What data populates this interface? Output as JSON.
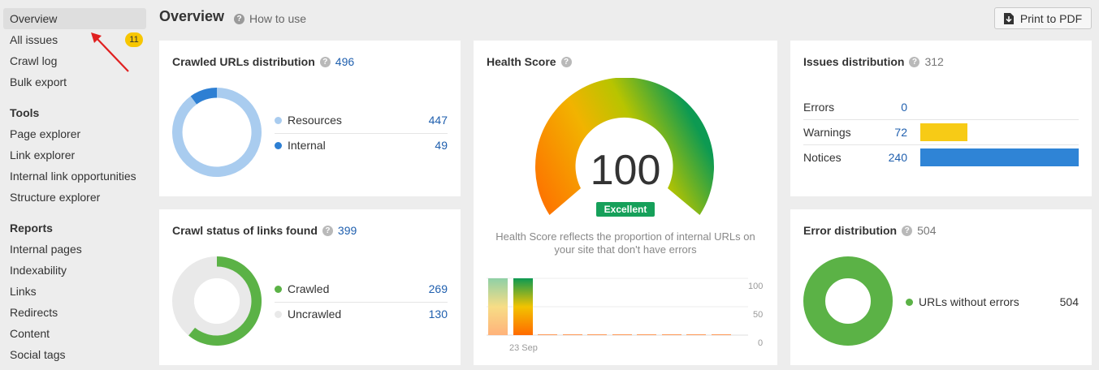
{
  "sidebar": {
    "overview": "Overview",
    "all_issues": "All issues",
    "all_issues_badge": "11",
    "crawl_log": "Crawl log",
    "bulk_export": "Bulk export",
    "tools_heading": "Tools",
    "tools": [
      "Page explorer",
      "Link explorer",
      "Internal link opportunities",
      "Structure explorer"
    ],
    "reports_heading": "Reports",
    "reports": [
      "Internal pages",
      "Indexability",
      "Links",
      "Redirects",
      "Content",
      "Social tags"
    ]
  },
  "header": {
    "title": "Overview",
    "how_to_use": "How to use",
    "print_button": "Print to PDF"
  },
  "crawled_urls": {
    "title": "Crawled URLs distribution",
    "total": "496",
    "items": [
      {
        "label": "Resources",
        "value": "447",
        "color": "#a9ccef"
      },
      {
        "label": "Internal",
        "value": "49",
        "color": "#2d7fd3"
      }
    ]
  },
  "crawl_status": {
    "title": "Crawl status of links found",
    "total": "399",
    "items": [
      {
        "label": "Crawled",
        "value": "269",
        "color": "#5bb246"
      },
      {
        "label": "Uncrawled",
        "value": "130",
        "color": "#e9e9e9"
      }
    ]
  },
  "health": {
    "title": "Health Score",
    "score": "100",
    "badge": "Excellent",
    "description": "Health Score reflects the proportion of internal URLs on your site that don't have errors",
    "date_label": "23 Sep",
    "axis": [
      "100",
      "50",
      "0"
    ]
  },
  "issues": {
    "title": "Issues distribution",
    "total": "312",
    "rows": [
      {
        "label": "Errors",
        "value": "0",
        "color": "#e54b4b"
      },
      {
        "label": "Warnings",
        "value": "72",
        "color": "#f7cb16"
      },
      {
        "label": "Notices",
        "value": "240",
        "color": "#2f84d6"
      }
    ]
  },
  "errors": {
    "title": "Error distribution",
    "total": "504",
    "items": [
      {
        "label": "URLs without errors",
        "value": "504",
        "color": "#5bb246"
      }
    ]
  }
}
